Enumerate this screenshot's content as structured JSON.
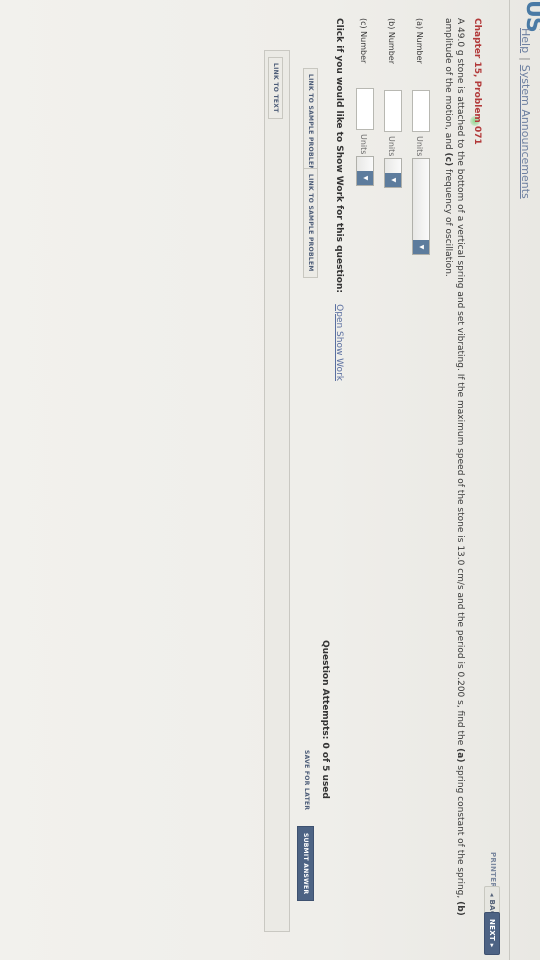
{
  "header": {
    "logo_fragment": "US",
    "help_link": "Help",
    "separator": "|",
    "announcements_link": "System Announcements"
  },
  "nav": {
    "printer_version": "PRINTER VERSION",
    "back": "◂ BACK",
    "next": "NEXT ▸"
  },
  "problem": {
    "chapter": "Chapter 15, Problem 071",
    "text_part1": "A 49.0 g stone is attached to the bottom of a vertical spring and set vibrating. If the maximum speed of the stone is 13.0 cm/s and the period is 0.200 s, find the ",
    "a_bold": "(a)",
    "text_part2": " spring constant of the spring, ",
    "b_bold": "(b)",
    "text_part3": " amplitude of the motion, and ",
    "c_bold": "(c)",
    "text_part4": " frequency of oscillation."
  },
  "answers": [
    {
      "label": "(a) Number",
      "value": "",
      "units_label": "Units",
      "units_value": ""
    },
    {
      "label": "(b) Number",
      "value": "",
      "units_label": "Units",
      "units_value": ""
    },
    {
      "label": "(c) Number",
      "value": "",
      "units_label": "Units",
      "units_value": ""
    }
  ],
  "show_work": {
    "prompt": "Click if you would like to Show Work for this question:",
    "link": "Open Show Work"
  },
  "buttons": {
    "sample1": "LINK TO SAMPLE PROBLEM",
    "sample2": "LINK TO SAMPLE PROBLEM",
    "link_to_text": "LINK TO TEXT",
    "save_later": "SAVE FOR LATER",
    "submit": "SUBMIT ANSWER"
  },
  "attempts": "Question Attempts: 0 of 5 used",
  "colors": {
    "accent": "#4d6384",
    "chapter_red": "#b23a3a",
    "link_blue": "#5a6fa0"
  }
}
